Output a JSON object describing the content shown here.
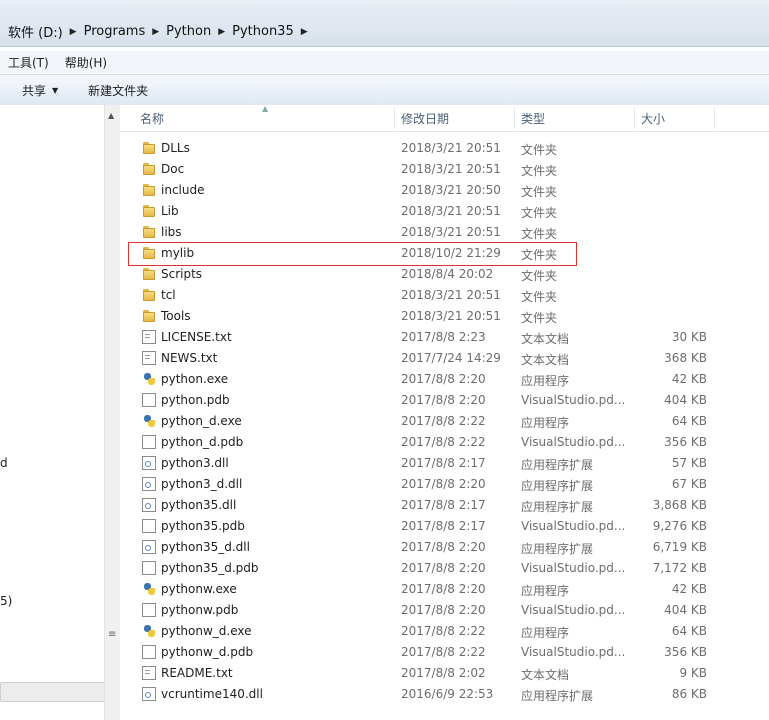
{
  "address": {
    "crumbs": [
      "软件 (D:)",
      "Programs",
      "Python",
      "Python35"
    ]
  },
  "menu": [
    "工具(T)",
    "帮助(H)"
  ],
  "toolbar": {
    "share_label": "共享",
    "new_folder_label": "新建文件夹"
  },
  "nav_fragments": [
    "d",
    "5)"
  ],
  "columns": {
    "name": "名称",
    "date": "修改日期",
    "type": "类型",
    "size": "大小"
  },
  "files": [
    {
      "name": "DLLs",
      "date": "2018/3/21 20:51",
      "type": "文件夹",
      "size": "",
      "icon": "folder-icon"
    },
    {
      "name": "Doc",
      "date": "2018/3/21 20:51",
      "type": "文件夹",
      "size": "",
      "icon": "folder-icon"
    },
    {
      "name": "include",
      "date": "2018/3/21 20:50",
      "type": "文件夹",
      "size": "",
      "icon": "folder-icon"
    },
    {
      "name": "Lib",
      "date": "2018/3/21 20:51",
      "type": "文件夹",
      "size": "",
      "icon": "folder-icon"
    },
    {
      "name": "libs",
      "date": "2018/3/21 20:51",
      "type": "文件夹",
      "size": "",
      "icon": "folder-icon"
    },
    {
      "name": "mylib",
      "date": "2018/10/2 21:29",
      "type": "文件夹",
      "size": "",
      "icon": "folder-icon"
    },
    {
      "name": "Scripts",
      "date": "2018/8/4 20:02",
      "type": "文件夹",
      "size": "",
      "icon": "folder-icon"
    },
    {
      "name": "tcl",
      "date": "2018/3/21 20:51",
      "type": "文件夹",
      "size": "",
      "icon": "folder-icon"
    },
    {
      "name": "Tools",
      "date": "2018/3/21 20:51",
      "type": "文件夹",
      "size": "",
      "icon": "folder-icon"
    },
    {
      "name": "LICENSE.txt",
      "date": "2017/8/8 2:23",
      "type": "文本文档",
      "size": "30 KB",
      "icon": "txt-icon"
    },
    {
      "name": "NEWS.txt",
      "date": "2017/7/24 14:29",
      "type": "文本文档",
      "size": "368 KB",
      "icon": "txt-icon"
    },
    {
      "name": "python.exe",
      "date": "2017/8/8 2:20",
      "type": "应用程序",
      "size": "42 KB",
      "icon": "exe-icon"
    },
    {
      "name": "python.pdb",
      "date": "2017/8/8 2:20",
      "type": "VisualStudio.pd...",
      "size": "404 KB",
      "icon": "pdb-icon"
    },
    {
      "name": "python_d.exe",
      "date": "2017/8/8 2:22",
      "type": "应用程序",
      "size": "64 KB",
      "icon": "exe-icon"
    },
    {
      "name": "python_d.pdb",
      "date": "2017/8/8 2:22",
      "type": "VisualStudio.pd...",
      "size": "356 KB",
      "icon": "pdb-icon"
    },
    {
      "name": "python3.dll",
      "date": "2017/8/8 2:17",
      "type": "应用程序扩展",
      "size": "57 KB",
      "icon": "dll-icon"
    },
    {
      "name": "python3_d.dll",
      "date": "2017/8/8 2:20",
      "type": "应用程序扩展",
      "size": "67 KB",
      "icon": "dll-icon"
    },
    {
      "name": "python35.dll",
      "date": "2017/8/8 2:17",
      "type": "应用程序扩展",
      "size": "3,868 KB",
      "icon": "dll-icon"
    },
    {
      "name": "python35.pdb",
      "date": "2017/8/8 2:17",
      "type": "VisualStudio.pd...",
      "size": "9,276 KB",
      "icon": "pdb-icon"
    },
    {
      "name": "python35_d.dll",
      "date": "2017/8/8 2:20",
      "type": "应用程序扩展",
      "size": "6,719 KB",
      "icon": "dll-icon"
    },
    {
      "name": "python35_d.pdb",
      "date": "2017/8/8 2:20",
      "type": "VisualStudio.pd...",
      "size": "7,172 KB",
      "icon": "pdb-icon"
    },
    {
      "name": "pythonw.exe",
      "date": "2017/8/8 2:20",
      "type": "应用程序",
      "size": "42 KB",
      "icon": "exe-icon"
    },
    {
      "name": "pythonw.pdb",
      "date": "2017/8/8 2:20",
      "type": "VisualStudio.pd...",
      "size": "404 KB",
      "icon": "pdb-icon"
    },
    {
      "name": "pythonw_d.exe",
      "date": "2017/8/8 2:22",
      "type": "应用程序",
      "size": "64 KB",
      "icon": "exe-icon"
    },
    {
      "name": "pythonw_d.pdb",
      "date": "2017/8/8 2:22",
      "type": "VisualStudio.pd...",
      "size": "356 KB",
      "icon": "pdb-icon"
    },
    {
      "name": "README.txt",
      "date": "2017/8/8 2:02",
      "type": "文本文档",
      "size": "9 KB",
      "icon": "txt-icon"
    },
    {
      "name": "vcruntime140.dll",
      "date": "2016/6/9 22:53",
      "type": "应用程序扩展",
      "size": "86 KB",
      "icon": "dll-icon"
    }
  ],
  "highlight_color": "#e03030"
}
